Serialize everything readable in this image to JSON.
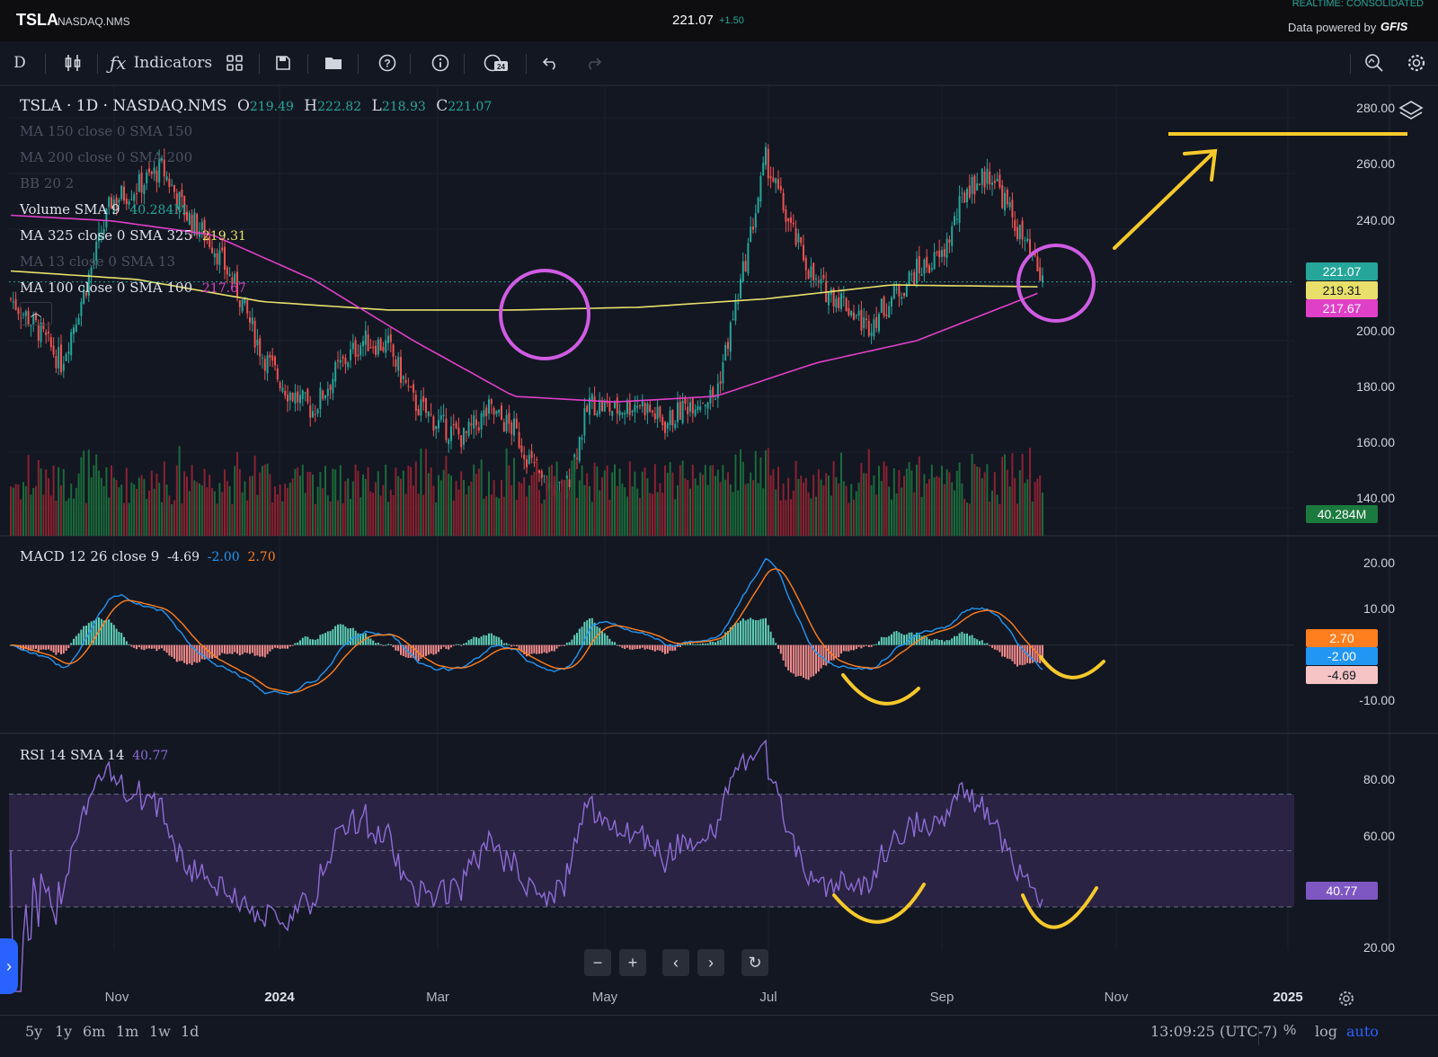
{
  "topbar": {
    "symbol": "TSLA",
    "exchange": "NASDAQ.NMS",
    "last_price": "221.07",
    "change": "+1.50",
    "realtime": "REALTIME: CONSOLIDATED",
    "powered_by": "Data powered by",
    "provider": "GFIS"
  },
  "toolbar": {
    "interval": "D",
    "indicators_label": "Indicators"
  },
  "legend": {
    "title": "TSLA · 1D · NASDAQ.NMS",
    "o_label": "O",
    "o": "219.49",
    "h_label": "H",
    "h": "222.82",
    "l_label": "L",
    "l": "218.93",
    "c_label": "C",
    "c": "221.07",
    "ma150": "MA 150 close 0 SMA 150",
    "ma200": "MA 200 close 0 SMA 200",
    "bb": "BB 20 2",
    "volume_label": "Volume SMA 9",
    "volume_value": "40.284M",
    "ma325_label": "MA 325 close 0 SMA 325",
    "ma325_value": "219.31",
    "ma13": "MA 13 close 0 SMA 13",
    "ma100_label": "MA 100 close 0 SMA 100",
    "ma100_value": "217.67",
    "macd_label": "MACD 12 26 close 9",
    "macd_v1": "-4.69",
    "macd_v2": "-2.00",
    "macd_v3": "2.70",
    "rsi_label": "RSI 14 SMA 14",
    "rsi_value": "40.77"
  },
  "price_axis": [
    "280.00",
    "260.00",
    "240.00",
    "200.00",
    "180.00",
    "160.00",
    "140.00"
  ],
  "price_tags": {
    "last": "221.07",
    "ma325": "219.31",
    "ma100": "217.67",
    "volume": "40.284M"
  },
  "macd_axis": [
    "20.00",
    "10.00",
    "-10.00"
  ],
  "macd_tags": {
    "signal_hist": "2.70",
    "signal": "-2.00",
    "macd": "-4.69"
  },
  "rsi_axis": [
    "80.00",
    "60.00",
    "20.00"
  ],
  "rsi_tag": "40.77",
  "time_axis": [
    "Nov",
    "2024",
    "Mar",
    "May",
    "Jul",
    "Sep",
    "Nov",
    "2025"
  ],
  "ranges": [
    "5y",
    "1y",
    "6m",
    "1m",
    "1w",
    "1d"
  ],
  "footer": {
    "time": "13:09:25 (UTC-7)",
    "percent": "%",
    "log": "log",
    "auto": "auto"
  },
  "colors": {
    "up": "#26a69a",
    "down": "#ef5350",
    "ma325": "#e8e06a",
    "ma100": "#e040c8",
    "macd": "#2196f3",
    "signal": "#ff7f1e",
    "rsi": "#8e6cd6",
    "annotation": "#f6c92b",
    "circle": "#d05ce3"
  },
  "chart_data": {
    "type": "candlestick",
    "close_path": [
      [
        0,
        215
      ],
      [
        10,
        205
      ],
      [
        20,
        192
      ],
      [
        30,
        220
      ],
      [
        40,
        250
      ],
      [
        50,
        255
      ],
      [
        60,
        262
      ],
      [
        70,
        245
      ],
      [
        80,
        235
      ],
      [
        90,
        218
      ],
      [
        100,
        195
      ],
      [
        110,
        182
      ],
      [
        120,
        175
      ],
      [
        130,
        190
      ],
      [
        140,
        200
      ],
      [
        150,
        198
      ],
      [
        160,
        178
      ],
      [
        170,
        170
      ],
      [
        180,
        165
      ],
      [
        190,
        175
      ],
      [
        200,
        168
      ],
      [
        210,
        150
      ],
      [
        220,
        145
      ],
      [
        230,
        178
      ],
      [
        240,
        175
      ],
      [
        250,
        178
      ],
      [
        260,
        170
      ],
      [
        270,
        178
      ],
      [
        280,
        180
      ],
      [
        290,
        220
      ],
      [
        300,
        265
      ],
      [
        310,
        240
      ],
      [
        320,
        220
      ],
      [
        330,
        215
      ],
      [
        340,
        205
      ],
      [
        350,
        215
      ],
      [
        360,
        225
      ],
      [
        370,
        230
      ],
      [
        380,
        255
      ],
      [
        390,
        260
      ],
      [
        400,
        240
      ],
      [
        410,
        221
      ]
    ],
    "ma325": [
      [
        0,
        225
      ],
      [
        50,
        222
      ],
      [
        100,
        214
      ],
      [
        150,
        211
      ],
      [
        200,
        211
      ],
      [
        250,
        212
      ],
      [
        300,
        215
      ],
      [
        350,
        220
      ],
      [
        410,
        219.31
      ]
    ],
    "ma100": [
      [
        0,
        245
      ],
      [
        40,
        243
      ],
      [
        80,
        238
      ],
      [
        120,
        222
      ],
      [
        160,
        200
      ],
      [
        200,
        180
      ],
      [
        240,
        178
      ],
      [
        280,
        180
      ],
      [
        320,
        192
      ],
      [
        360,
        200
      ],
      [
        410,
        217.67
      ]
    ],
    "price_ylim": [
      130,
      290
    ],
    "macd_ylim": [
      -20,
      25
    ],
    "rsi_ylim": [
      15,
      90
    ],
    "rsi_bands": [
      30,
      50,
      70
    ]
  }
}
